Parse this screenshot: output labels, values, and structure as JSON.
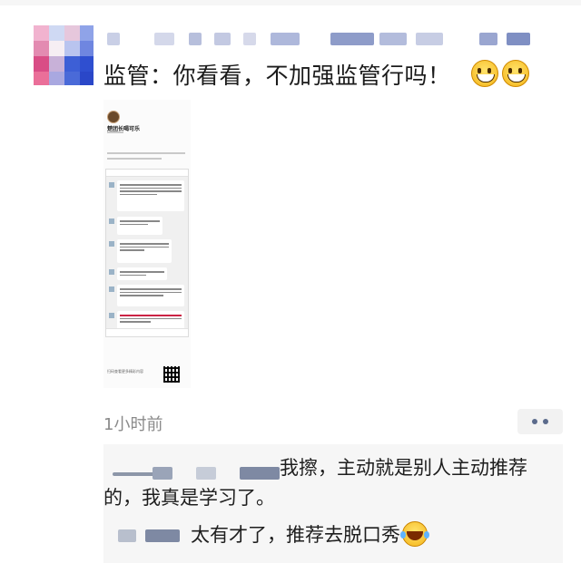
{
  "post": {
    "text": "监管：你看看，不加强监管行吗！",
    "emojis": [
      "grin-emoji",
      "grin-emoji"
    ]
  },
  "shared_image": {
    "account_name": "楚团长喝可乐",
    "footer_text": "扫码查看更多精彩内容"
  },
  "meta": {
    "time": "1小时前"
  },
  "comments": [
    {
      "text": "我擦，主动就是别人主动推荐的，我真是学习了。"
    },
    {
      "text": "太有才了，推荐去脱口秀",
      "emoji": "laughing-tears-emoji"
    }
  ]
}
